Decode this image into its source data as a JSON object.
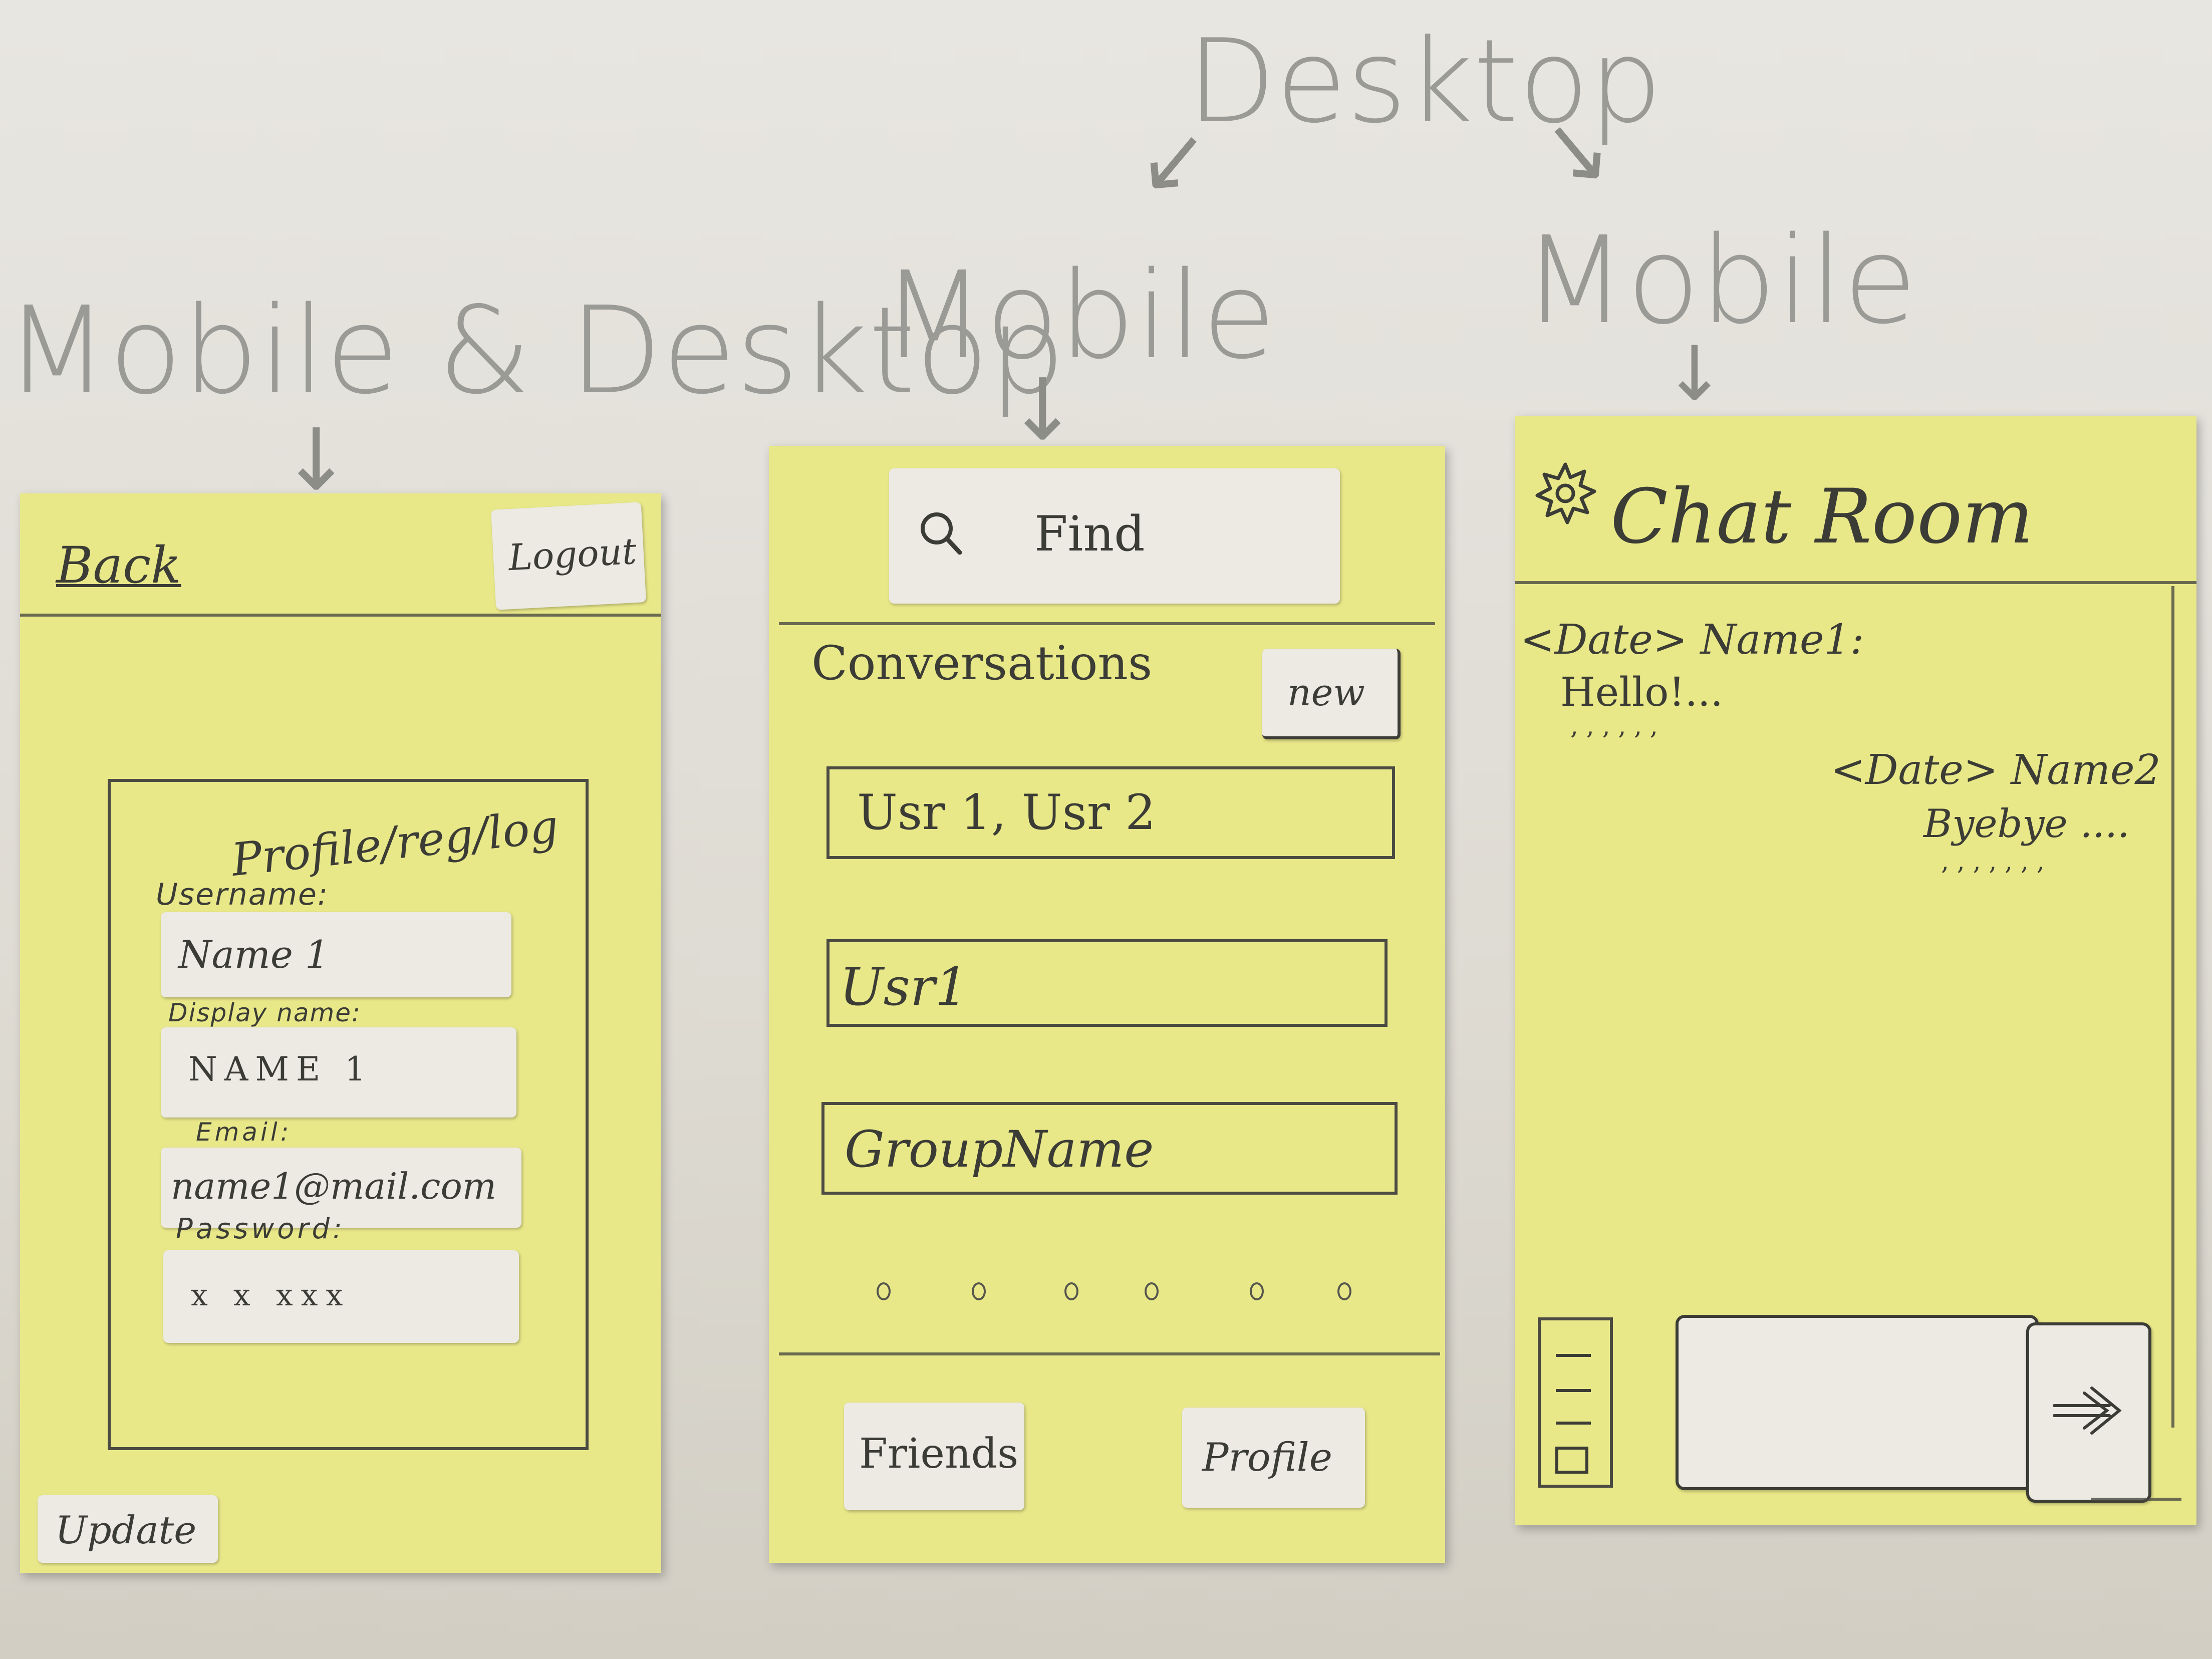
{
  "annotations": {
    "desktop": "Desktop",
    "mobile_desktop": "Mobile & Desktop",
    "mobile_center": "Mobile",
    "mobile_right": "Mobile"
  },
  "profile_screen": {
    "back_link": "Back",
    "logout_button": "Logout",
    "panel_title": "Profile/reg/log",
    "username_label": "Username:",
    "username_value": "Name 1",
    "display_name_label": "Display name:",
    "display_name_value": "NAME 1",
    "email_label": "Email:",
    "email_value": "name1@mail.com",
    "password_label": "Password:",
    "password_value": "x x xxx",
    "update_button": "Update"
  },
  "conversations_screen": {
    "search_placeholder": "Find",
    "section_title": "Conversations",
    "new_button": "new",
    "conversations": [
      {
        "label": "Usr 1, Usr 2"
      },
      {
        "label": "Usr1"
      },
      {
        "label": "GroupName"
      }
    ],
    "friends_button": "Friends",
    "profile_button": "Profile"
  },
  "chat_screen": {
    "title": "Chat Room",
    "messages": [
      {
        "header": "<Date> Name1:",
        "text": "Hello!...",
        "filler": ", , , , , ,"
      },
      {
        "header": "<Date> Name2",
        "text": "Byebye ....",
        "filler": ", , , , ,  , ,"
      }
    ],
    "send_icon": "double-arrow-icon",
    "menu_icon": "menu-icon",
    "settings_icon": "gear-icon"
  }
}
